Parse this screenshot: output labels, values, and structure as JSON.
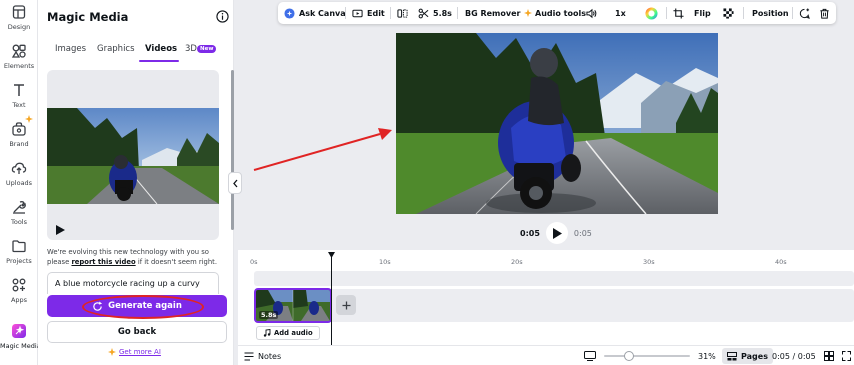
{
  "rail": {
    "items": [
      {
        "label": "Design",
        "icon": "design-icon"
      },
      {
        "label": "Elements",
        "icon": "elements-icon"
      },
      {
        "label": "Text",
        "icon": "text-icon"
      },
      {
        "label": "Brand",
        "icon": "brand-icon"
      },
      {
        "label": "Uploads",
        "icon": "uploads-icon"
      },
      {
        "label": "Tools",
        "icon": "tools-icon"
      },
      {
        "label": "Projects",
        "icon": "projects-icon"
      },
      {
        "label": "Apps",
        "icon": "apps-icon"
      },
      {
        "label": "Magic Media",
        "icon": "magic-media-icon"
      }
    ]
  },
  "panel": {
    "title": "Magic Media",
    "tabs": [
      {
        "label": "Images"
      },
      {
        "label": "Graphics"
      },
      {
        "label": "Videos"
      },
      {
        "label": "3D",
        "badge": "New"
      }
    ],
    "notice_text": "We're evolving this new technology with you so please",
    "notice_link": "report this video",
    "notice_tail": " if it doesn't seem right.",
    "prompt_value": "A blue motorcycle racing up a curvy",
    "generate_label": "Generate again",
    "back_label": "Go back",
    "get_more_label": "Get more AI"
  },
  "toolbar": {
    "ask_canva": "Ask Canva",
    "edit": "Edit",
    "duration": "5.8s",
    "bg_remover": "BG Remover",
    "audio_tools": "Audio tools",
    "speed": "1x",
    "flip": "Flip",
    "position": "Position"
  },
  "player": {
    "current": "0:05",
    "total": "0:05"
  },
  "timeline": {
    "ruler": [
      "0s",
      "10s",
      "20s",
      "30s",
      "40s"
    ],
    "clip_duration": "5.8s",
    "add_audio": "Add audio"
  },
  "statusbar": {
    "notes": "Notes",
    "zoom": "31%",
    "pages": "Pages",
    "time": "0:05 / 0:05"
  },
  "colors": {
    "accent": "#7d2ae8",
    "annotation": "#e02424"
  }
}
